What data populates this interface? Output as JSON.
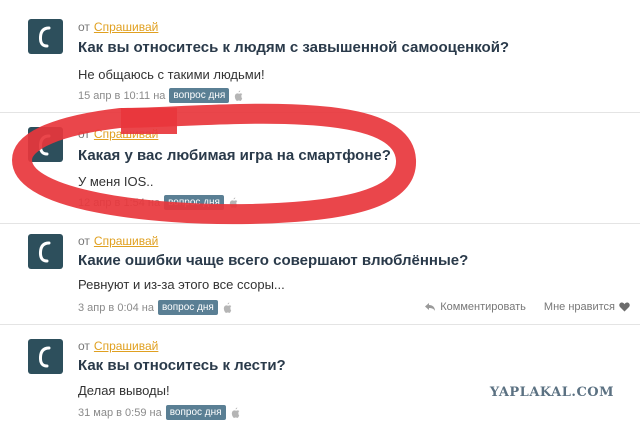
{
  "posts": [
    {
      "from_label": "от",
      "author": "Спрашивай",
      "question": "Как вы относитесь к людям с завышенной самооценкой?",
      "answer": "Не общаюсь с такими людьми!",
      "timestamp": "15 апр в 10:11 на",
      "tag": "вопрос дня",
      "platform_icon": "apple-icon"
    },
    {
      "from_label": "от",
      "author": "Спрашивай",
      "question": "Какая у вас любимая игра на смартфоне?",
      "answer": "У меня IOS..",
      "timestamp": "12 апр в 1:54 на",
      "tag": "вопрос дня",
      "platform_icon": "apple-icon"
    },
    {
      "from_label": "от",
      "author": "Спрашивай",
      "question": "Какие ошибки чаще всего совершают влюблённые?",
      "answer": "Ревнуют и из-за этого все ссоры...",
      "timestamp": "3 апр в 0:04 на",
      "tag": "вопрос дня",
      "platform_icon": "apple-icon",
      "comment_label": "Комментировать",
      "like_label": "Мне нравится"
    },
    {
      "from_label": "от",
      "author": "Спрашивай",
      "question": "Как вы относитесь к лести?",
      "answer": "Делая выводы!",
      "timestamp": "31 мар в 0:59 на",
      "tag": "вопрос дня",
      "platform_icon": "apple-icon"
    }
  ],
  "watermark": "YAPLAKAL.COM",
  "colors": {
    "avatar_bg": "#2d4f5c",
    "author_link": "#e0a020",
    "tag_bg": "#5a7f94",
    "highlight_circle": "#e8363c"
  }
}
